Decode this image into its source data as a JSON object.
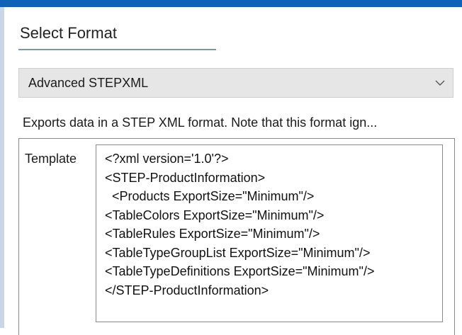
{
  "section": {
    "title": "Select Format"
  },
  "format_select": {
    "value": "Advanced STEPXML",
    "icon": "chevron-down-icon"
  },
  "description": "Exports data in a STEP XML format. Note that this format ign...",
  "template": {
    "label": "Template",
    "lines": [
      "<?xml version='1.0'?>",
      "<STEP-ProductInformation>",
      "  <Products ExportSize=\"Minimum\"/>",
      "<TableColors ExportSize=\"Minimum\"/>",
      "<TableRules ExportSize=\"Minimum\"/>",
      "<TableTypeGroupList ExportSize=\"Minimum\"/>",
      "<TableTypeDefinitions ExportSize=\"Minimum\"/>",
      "</STEP-ProductInformation>"
    ]
  },
  "colors": {
    "accent": "#0e63b8",
    "underline": "#7f95a8",
    "select_bg": "#e6e6e6"
  }
}
